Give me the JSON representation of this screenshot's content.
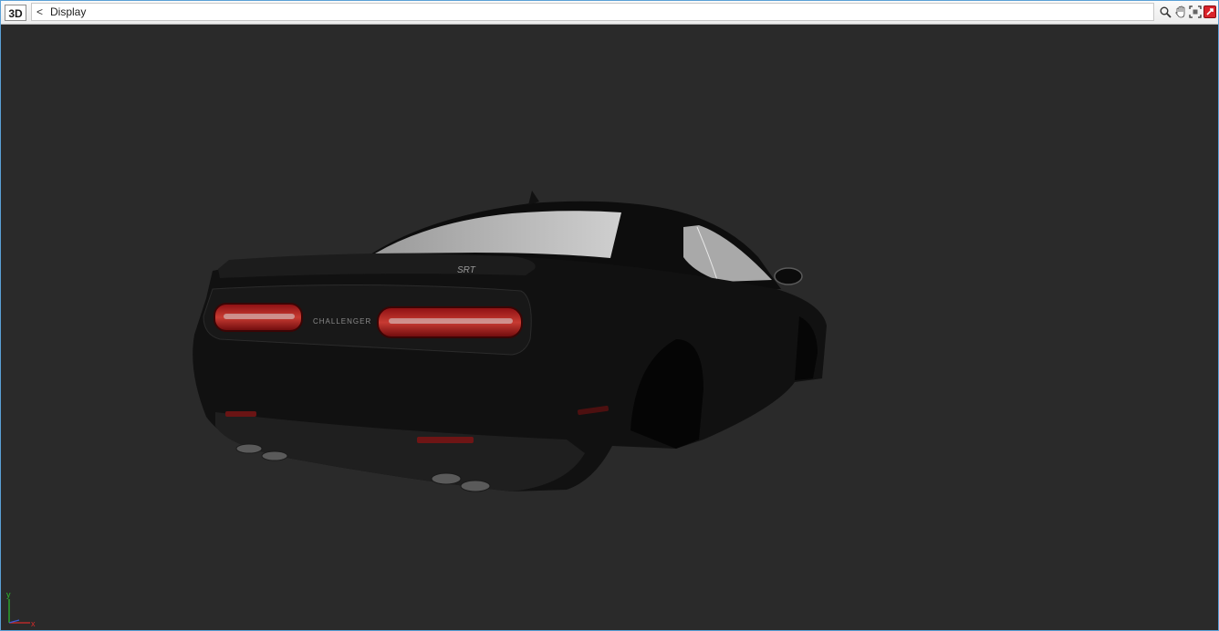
{
  "toolbar": {
    "view_mode_label": "3D",
    "back_label": "<",
    "title": "Display",
    "tools": [
      {
        "icon": "zoom-icon"
      },
      {
        "icon": "pan-hand-icon"
      },
      {
        "icon": "fit-view-icon"
      },
      {
        "icon": "close-red-icon"
      }
    ]
  },
  "viewport": {
    "background_color": "#2a2a2a",
    "model": {
      "badge_text": "SRT",
      "rear_text": "CHALLENGER"
    },
    "axis": {
      "y_label": "y",
      "x_label": "x"
    }
  }
}
